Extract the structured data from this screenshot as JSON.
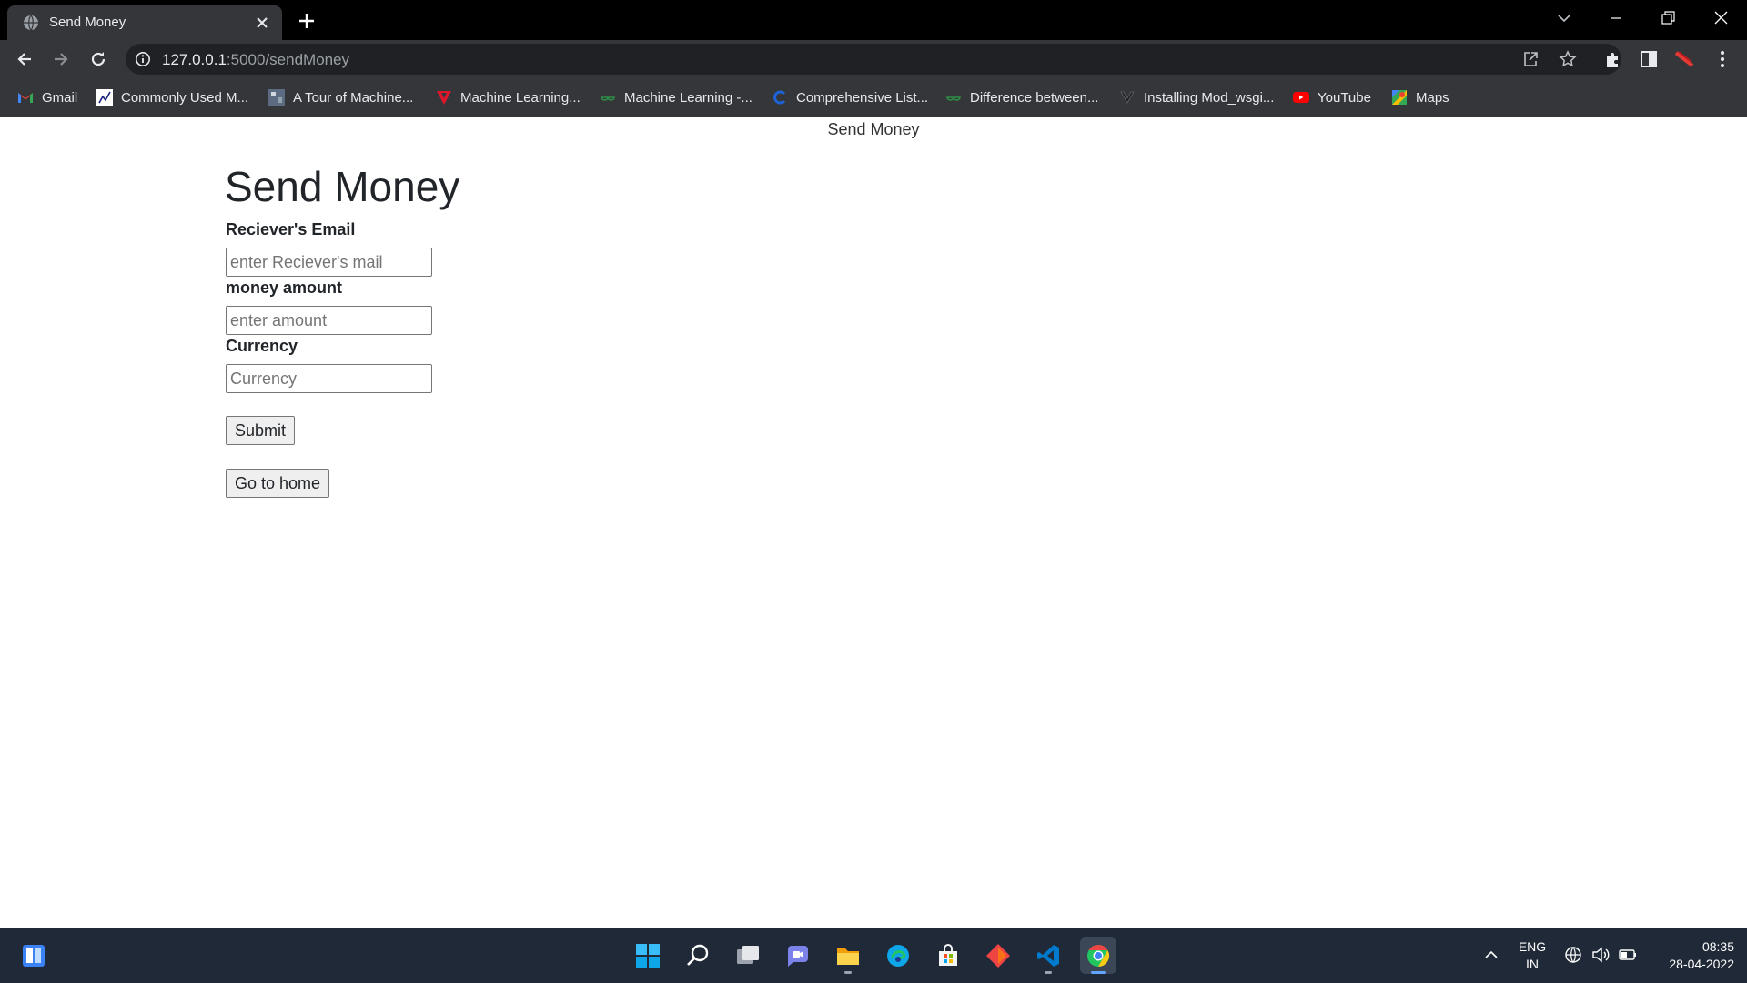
{
  "browser": {
    "tab": {
      "title": "Send Money"
    },
    "address": {
      "host": "127.0.0.1",
      "path": ":5000/sendMoney"
    },
    "bookmarks": [
      {
        "label": "Gmail",
        "icon": "gmail-icon"
      },
      {
        "label": "Commonly Used M...",
        "icon": "chart-icon"
      },
      {
        "label": "A Tour of Machine...",
        "icon": "thumbnail-icon"
      },
      {
        "label": "Machine Learning...",
        "icon": "red-v-icon"
      },
      {
        "label": "Machine Learning -...",
        "icon": "geeks-icon"
      },
      {
        "label": "Comprehensive List...",
        "icon": "blue-c-icon"
      },
      {
        "label": "Difference between...",
        "icon": "geeks-icon"
      },
      {
        "label": "Installing Mod_wsgi...",
        "icon": "dark-v-icon"
      },
      {
        "label": "YouTube",
        "icon": "youtube-icon"
      },
      {
        "label": "Maps",
        "icon": "maps-icon"
      }
    ]
  },
  "page": {
    "doc_title": "Send Money",
    "heading": "Send Money",
    "fields": [
      {
        "label": "Reciever's Email",
        "placeholder": "enter Reciever's mail",
        "value": ""
      },
      {
        "label": "money amount",
        "placeholder": "enter amount",
        "value": ""
      },
      {
        "label": "Currency",
        "placeholder": "Currency",
        "value": ""
      }
    ],
    "submit_label": "Submit",
    "home_label": "Go to home"
  },
  "taskbar": {
    "language": "ENG",
    "region": "IN",
    "time": "08:35",
    "date": "28-04-2022",
    "apps": [
      "start-icon",
      "search-icon",
      "task-view-icon",
      "teams-chat-icon",
      "file-explorer-icon",
      "edge-icon",
      "store-icon",
      "git-icon",
      "vscode-icon",
      "chrome-icon"
    ]
  },
  "colors": {
    "tab_strip": "#000000",
    "toolbar": "#35363a",
    "omnibox": "#202124",
    "taskbar": "#1f2937",
    "page_text": "#212529"
  }
}
